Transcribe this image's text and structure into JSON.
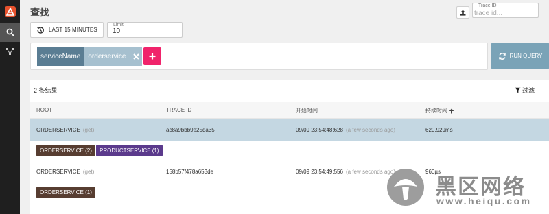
{
  "page": {
    "title": "查找"
  },
  "search": {
    "trace_id_label": "Trace ID",
    "trace_id_placeholder": "trace id...",
    "lookback_label": "LAST 15 MINUTES",
    "limit_label": "Limit",
    "limit_value": "10",
    "criteria": [
      {
        "key": "serviceName",
        "value": "orderservice"
      }
    ],
    "run_label": "RUN QUERY"
  },
  "results": {
    "count_text": "2 条结果",
    "filter_label": "过滤",
    "columns": {
      "root": "ROOT",
      "trace_id": "TRACE ID",
      "start_time": "开始时间",
      "duration": "持续时间"
    },
    "rows": [
      {
        "root_service": "ORDERSERVICE",
        "root_method": "(get)",
        "trace_id": "ac8a9bbb9e25da35",
        "start_time": "09/09 23:54:48:628",
        "start_relative": "(a few seconds ago)",
        "duration": "620.929ms",
        "services": [
          {
            "label": "ORDERSERVICE (2)"
          },
          {
            "label": "PRODUCTSERVICE (1)"
          }
        ]
      },
      {
        "root_service": "ORDERSERVICE",
        "root_method": "(get)",
        "trace_id": "158b57f478a653de",
        "start_time": "09/09 23:54:49:556",
        "start_relative": "(a few seconds ago)",
        "duration": "960µs",
        "services": [
          {
            "label": "ORDERSERVICE (1)"
          }
        ]
      }
    ]
  },
  "watermark": {
    "text": "黑区网络",
    "url": "www.heiqu.com"
  },
  "colors": {
    "sidebar": "#1f1f1f",
    "chip_key": "#5a7d93",
    "chip_value": "#a6c0cf",
    "add_button": "#f0236b",
    "run_button": "#7aa3b7",
    "selected_row": "#c4d7e2",
    "badge_order": "#573d31",
    "badge_product": "#5b3a8c"
  }
}
